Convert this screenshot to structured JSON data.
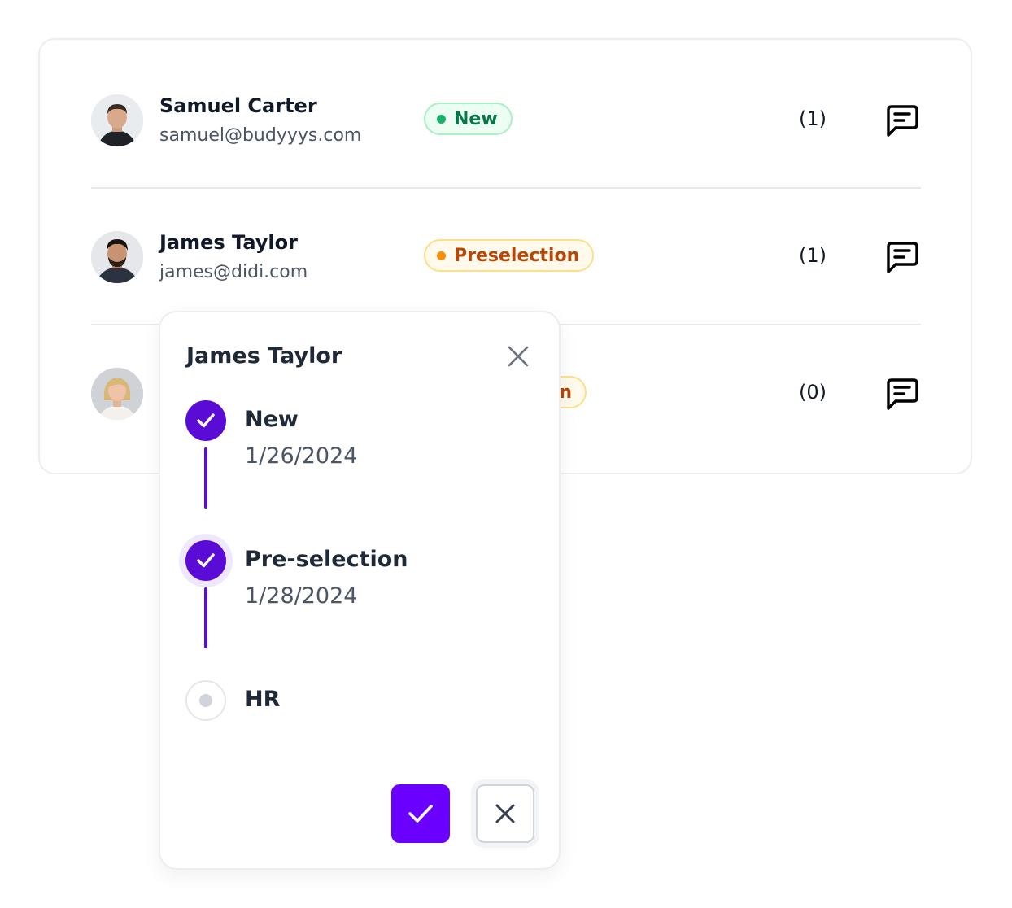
{
  "candidates": [
    {
      "name": "Samuel Carter",
      "email": "samuel@budyyys.com",
      "status": "New",
      "status_color": "#17b26a",
      "count": "(1)",
      "avatar": "avatar-man-short-hair"
    },
    {
      "name": "James Taylor",
      "email": "james@didi.com",
      "status": "Preselection",
      "status_color": "#f79009",
      "count": "(1)",
      "avatar": "avatar-man-beard"
    },
    {
      "name": "",
      "email": "",
      "status_partial": "n",
      "status_color": "#f79009",
      "count": "(0)",
      "avatar": "avatar-woman-blonde"
    }
  ],
  "popover": {
    "title": "James Taylor",
    "steps": [
      {
        "label": "New",
        "date": "1/26/2024",
        "state": "done"
      },
      {
        "label": "Pre-selection",
        "date": "1/28/2024",
        "state": "current"
      },
      {
        "label": "HR",
        "date": "",
        "state": "todo"
      }
    ],
    "accent_color": "#5b0bd6",
    "confirm_icon": "check-icon",
    "cancel_icon": "close-icon"
  },
  "icons": {
    "message": "message-square-icon",
    "close": "close-icon"
  }
}
